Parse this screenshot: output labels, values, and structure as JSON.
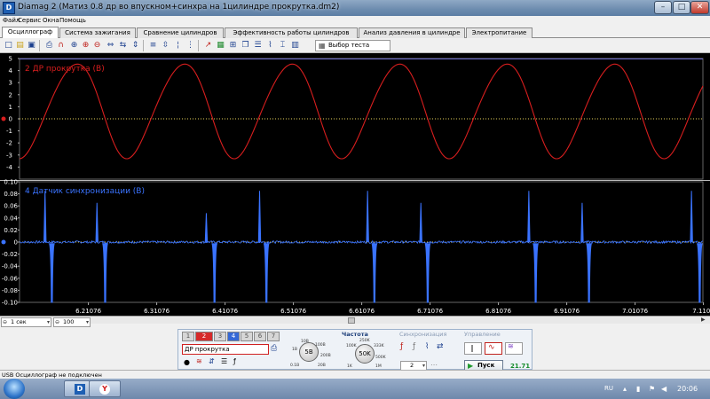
{
  "window": {
    "title": "Diamag 2 (Матиз 0.8 др во впускном+синхра на 1цилиндре прокрутка.dm2)",
    "app_icon_label": "D",
    "controls": {
      "minimize": "–",
      "maximize": "□",
      "close": "✕"
    }
  },
  "menu": [
    "Файл",
    "Сервис",
    "Окна",
    "Помощь"
  ],
  "tabs": [
    {
      "label": "Осциллограф",
      "active": true
    },
    {
      "label": "Система зажигания",
      "active": false
    },
    {
      "label": "Сравнение цилиндров",
      "active": false
    },
    {
      "label": "Эффективность работы цилиндров",
      "active": false
    },
    {
      "label": "Анализ давления в цилиндре",
      "active": false
    },
    {
      "label": "Электропитание",
      "active": false
    }
  ],
  "toolbar": {
    "test_select": "Выбор теста",
    "icons": [
      "new-file-icon",
      "open-file-icon",
      "save-icon",
      "print-icon",
      "cursor-icon",
      "magnet-icon",
      "zoom-fit-icon",
      "zoom-in-icon",
      "zoom-out-icon",
      "expand-horizontal-icon",
      "compress-horizontal-icon",
      "expand-vertical-icon",
      "compress-vertical-icon",
      "ruler-icon",
      "marker-icon",
      "grid-icon",
      "trend-icon",
      "frame-icon",
      "copy-icon",
      "settings-icon"
    ]
  },
  "chart_data": [
    {
      "type": "line",
      "title": "2 ДР прокрутка (В)",
      "color": "#d81e1e",
      "ylim": [
        -5,
        5
      ],
      "y_ticks": [
        "5",
        "4",
        "3",
        "2",
        "1",
        "0",
        "-1",
        "-2",
        "-3",
        "-4"
      ],
      "series": [
        {
          "name": "2 ДР прокрутка (В)",
          "period": 0.1573,
          "min": -3.6,
          "max": 4.7,
          "first_peak_x": 6.1877
        }
      ],
      "xlim": [
        6.11,
        7.11
      ]
    },
    {
      "type": "line",
      "title": "4 Датчик синхронизации (В)",
      "color": "#3a73ff",
      "ylim": [
        -0.1,
        0.1
      ],
      "y_ticks": [
        "0.10",
        "0.08",
        "0.06",
        "0.04",
        "0.02",
        "0",
        "-0.02",
        "-0.04",
        "-0.06",
        "-0.08",
        "-0.10"
      ],
      "series": [
        {
          "name": "4 Датчик синхронизации (В)",
          "positive_spikes_x": [
            6.1473,
            6.2233,
            6.3833,
            6.4613,
            6.6193,
            6.6973,
            6.8553,
            6.9333,
            7.0933
          ],
          "positive_spike_peaks": [
            0.085,
            0.065,
            0.048,
            0.085,
            0.085,
            0.065,
            0.085,
            0.065,
            0.085
          ],
          "negative_spikes_x": [
            6.1573,
            6.2353,
            6.3953,
            6.4713,
            6.6293,
            6.7073,
            6.8653,
            6.9433,
            7.1053
          ],
          "negative_spike_troughs": [
            -0.1,
            -0.1,
            -0.1,
            -0.1,
            -0.1,
            -0.1,
            -0.1,
            -0.1,
            -0.1
          ]
        }
      ],
      "xlim": [
        6.11,
        7.11
      ]
    }
  ],
  "x_axis_ticks": [
    "6.21076",
    "6.31076",
    "6.41076",
    "6.51076",
    "6.61076",
    "6.71076",
    "6.81076",
    "6.91076",
    "7.01076",
    "7.1107"
  ],
  "bottom": {
    "timebase": "1 сек",
    "points": "100",
    "channels": [
      "1",
      "2",
      "3",
      "4",
      "5",
      "6",
      "7"
    ],
    "channel_name": "ДР прокрутка",
    "volt_section": {
      "value": "5В",
      "ticks": [
        "10В",
        "100В",
        "200В",
        "0.1В",
        "1В",
        "20В"
      ]
    },
    "freq_section": {
      "title": "Частота",
      "value": "50K",
      "ticks": [
        "250K",
        "100K",
        "333K",
        "500K",
        "1K",
        "1M"
      ]
    },
    "sync_section": {
      "title": "Синхронизация",
      "value": "2"
    },
    "control_section": {
      "title": "Управление",
      "start_label": "Пуск",
      "fps": "21.71"
    }
  },
  "status": "USB Осциллограф не подключен",
  "taskbar": {
    "lang": "RU",
    "clock": "20:06"
  }
}
